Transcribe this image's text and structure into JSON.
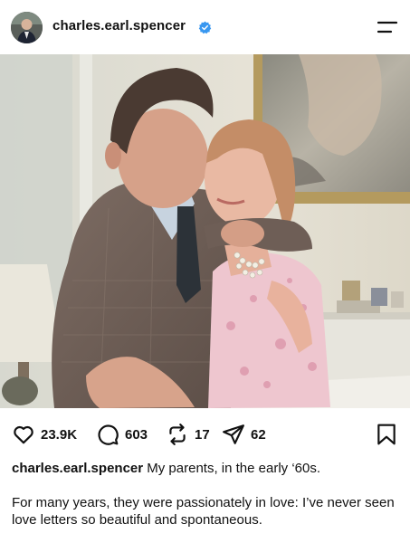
{
  "header": {
    "username": "charles.earl.spencer",
    "avatar_icon": "profile-photo-icon",
    "verified_icon": "verified-badge-icon",
    "menu_icon": "menu-icon",
    "accent_color": "#3897f0"
  },
  "post": {
    "image_icon": "couple-embracing-photo",
    "actions": {
      "like_icon": "heart-icon",
      "likes": "23.9K",
      "comment_icon": "comment-bubble-icon",
      "comments": "603",
      "repost_icon": "repost-icon",
      "reposts": "17",
      "share_icon": "send-icon",
      "shares": "62",
      "save_icon": "bookmark-icon"
    },
    "caption": {
      "username": "charles.earl.spencer",
      "text_line1": "My parents, in the early ‘60s.",
      "text_para2": "For many years, they were passionately in love: I’ve never seen love letters so beautiful and spontaneous."
    }
  }
}
